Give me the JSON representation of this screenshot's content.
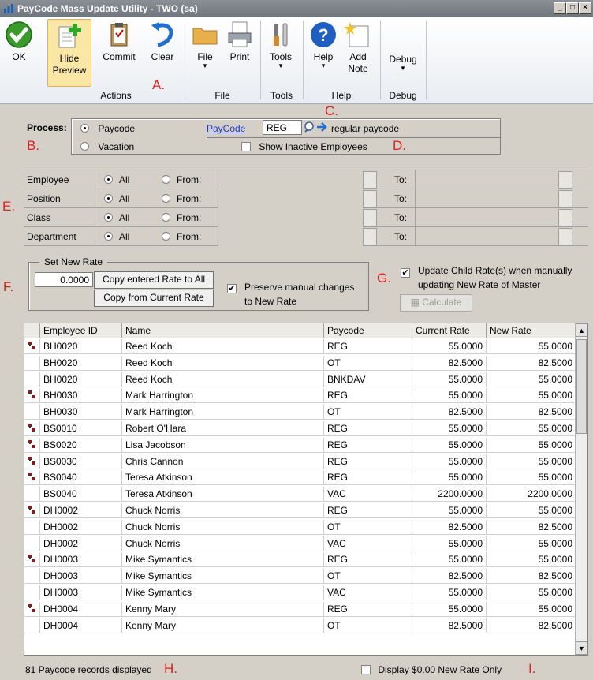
{
  "window": {
    "title": "PayCode Mass Update Utility  -  TWO (sa)"
  },
  "ribbon": {
    "ok": "OK",
    "hide_preview": "Hide Preview",
    "commit": "Commit",
    "clear": "Clear",
    "file": "File",
    "print": "Print",
    "tools": "Tools",
    "help": "Help",
    "add_note": "Add Note",
    "debug": "Debug",
    "groups": {
      "actions": "Actions",
      "file": "File",
      "tools": "Tools",
      "help": "Help",
      "debug": "Debug"
    }
  },
  "annotations": {
    "a": "A.",
    "b": "B.",
    "c": "C.",
    "d": "D.",
    "e": "E.",
    "f": "F.",
    "g": "G.",
    "h": "H.",
    "i": "I."
  },
  "process": {
    "label": "Process:",
    "option_paycode": "Paycode",
    "option_vacation": "Vacation",
    "selected": "Paycode",
    "paycode_link": "PayCode",
    "paycode_value": "REG",
    "paycode_desc": "regular paycode",
    "show_inactive": "Show Inactive Employees",
    "show_inactive_checked": false
  },
  "ranges": {
    "all_label": "All",
    "from_label": "From:",
    "to_label": "To:",
    "rows": [
      {
        "label": "Employee"
      },
      {
        "label": "Position"
      },
      {
        "label": "Class"
      },
      {
        "label": "Department"
      }
    ]
  },
  "set_rate": {
    "legend": "Set New Rate",
    "rate_value": "0.0000",
    "copy_entered": "Copy entered Rate to All",
    "copy_current": "Copy from Current Rate",
    "preserve_label": "Preserve manual changes to New Rate",
    "preserve_checked": true,
    "update_child_label": "Update Child Rate(s) when manually updating New Rate of Master",
    "update_child_checked": true,
    "calculate": "Calculate"
  },
  "table": {
    "columns": [
      "Employee ID",
      "Name",
      "Paycode",
      "Current Rate",
      "New Rate"
    ],
    "rows": [
      {
        "tree": true,
        "id": "BH0020",
        "name": "Reed Koch",
        "paycode": "REG",
        "current": "55.0000",
        "new": "55.0000"
      },
      {
        "tree": false,
        "id": "BH0020",
        "name": "Reed Koch",
        "paycode": "OT",
        "current": "82.5000",
        "new": "82.5000"
      },
      {
        "tree": false,
        "id": "BH0020",
        "name": "Reed Koch",
        "paycode": "BNKDAV",
        "current": "55.0000",
        "new": "55.0000"
      },
      {
        "tree": true,
        "id": "BH0030",
        "name": "Mark Harrington",
        "paycode": "REG",
        "current": "55.0000",
        "new": "55.0000"
      },
      {
        "tree": false,
        "id": "BH0030",
        "name": "Mark Harrington",
        "paycode": "OT",
        "current": "82.5000",
        "new": "82.5000"
      },
      {
        "tree": true,
        "id": "BS0010",
        "name": "Robert O'Hara",
        "paycode": "REG",
        "current": "55.0000",
        "new": "55.0000"
      },
      {
        "tree": true,
        "id": "BS0020",
        "name": "Lisa Jacobson",
        "paycode": "REG",
        "current": "55.0000",
        "new": "55.0000"
      },
      {
        "tree": true,
        "id": "BS0030",
        "name": "Chris Cannon",
        "paycode": "REG",
        "current": "55.0000",
        "new": "55.0000"
      },
      {
        "tree": true,
        "id": "BS0040",
        "name": "Teresa Atkinson",
        "paycode": "REG",
        "current": "55.0000",
        "new": "55.0000"
      },
      {
        "tree": false,
        "id": "BS0040",
        "name": "Teresa Atkinson",
        "paycode": "VAC",
        "current": "2200.0000",
        "new": "2200.0000"
      },
      {
        "tree": true,
        "id": "DH0002",
        "name": "Chuck Norris",
        "paycode": "REG",
        "current": "55.0000",
        "new": "55.0000"
      },
      {
        "tree": false,
        "id": "DH0002",
        "name": "Chuck Norris",
        "paycode": "OT",
        "current": "82.5000",
        "new": "82.5000"
      },
      {
        "tree": false,
        "id": "DH0002",
        "name": "Chuck Norris",
        "paycode": "VAC",
        "current": "55.0000",
        "new": "55.0000"
      },
      {
        "tree": true,
        "id": "DH0003",
        "name": "Mike Symantics",
        "paycode": "REG",
        "current": "55.0000",
        "new": "55.0000"
      },
      {
        "tree": false,
        "id": "DH0003",
        "name": "Mike Symantics",
        "paycode": "OT",
        "current": "82.5000",
        "new": "82.5000"
      },
      {
        "tree": false,
        "id": "DH0003",
        "name": "Mike Symantics",
        "paycode": "VAC",
        "current": "55.0000",
        "new": "55.0000"
      },
      {
        "tree": true,
        "id": "DH0004",
        "name": "Kenny Mary",
        "paycode": "REG",
        "current": "55.0000",
        "new": "55.0000"
      },
      {
        "tree": false,
        "id": "DH0004",
        "name": "Kenny Mary",
        "paycode": "OT",
        "current": "82.5000",
        "new": "82.5000"
      }
    ]
  },
  "footer": {
    "records": "81 Paycode records displayed",
    "display_zero": "Display $0.00 New Rate Only",
    "display_zero_checked": false
  }
}
